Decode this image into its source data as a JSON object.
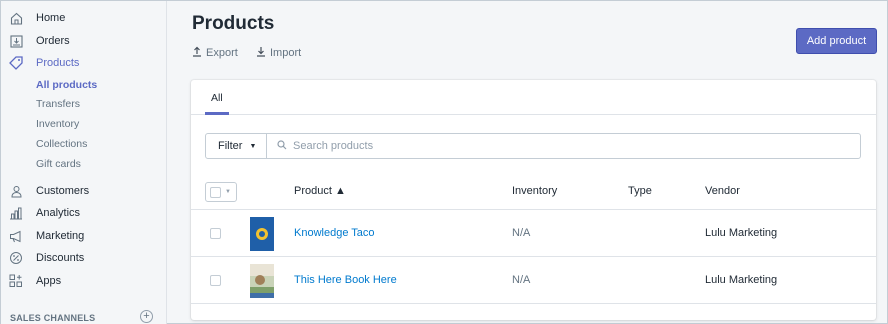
{
  "sidebar": {
    "items": [
      {
        "label": "Home",
        "icon": "home-icon"
      },
      {
        "label": "Orders",
        "icon": "orders-icon"
      },
      {
        "label": "Products",
        "icon": "tag-icon"
      },
      {
        "label": "Customers",
        "icon": "person-icon"
      },
      {
        "label": "Analytics",
        "icon": "bar-chart-icon"
      },
      {
        "label": "Marketing",
        "icon": "megaphone-icon"
      },
      {
        "label": "Discounts",
        "icon": "discount-icon"
      },
      {
        "label": "Apps",
        "icon": "apps-icon"
      }
    ],
    "sub_items": [
      "All products",
      "Transfers",
      "Inventory",
      "Collections",
      "Gift cards"
    ],
    "channels_label": "SALES CHANNELS",
    "channels_add": "+"
  },
  "header": {
    "title": "Products",
    "export_label": "Export",
    "import_label": "Import",
    "add_label": "Add product"
  },
  "tabs": [
    "All"
  ],
  "filter": {
    "label": "Filter",
    "search_placeholder": "Search products"
  },
  "table": {
    "columns": [
      "Product ▲",
      "Inventory",
      "Type",
      "Vendor"
    ],
    "rows": [
      {
        "product": "Knowledge Taco",
        "inventory": "N/A",
        "type": "",
        "vendor": "Lulu Marketing"
      },
      {
        "product": "This Here Book Here",
        "inventory": "N/A",
        "type": "",
        "vendor": "Lulu Marketing"
      }
    ]
  },
  "colors": {
    "accent": "#5c6ac4",
    "link": "#007ace"
  }
}
